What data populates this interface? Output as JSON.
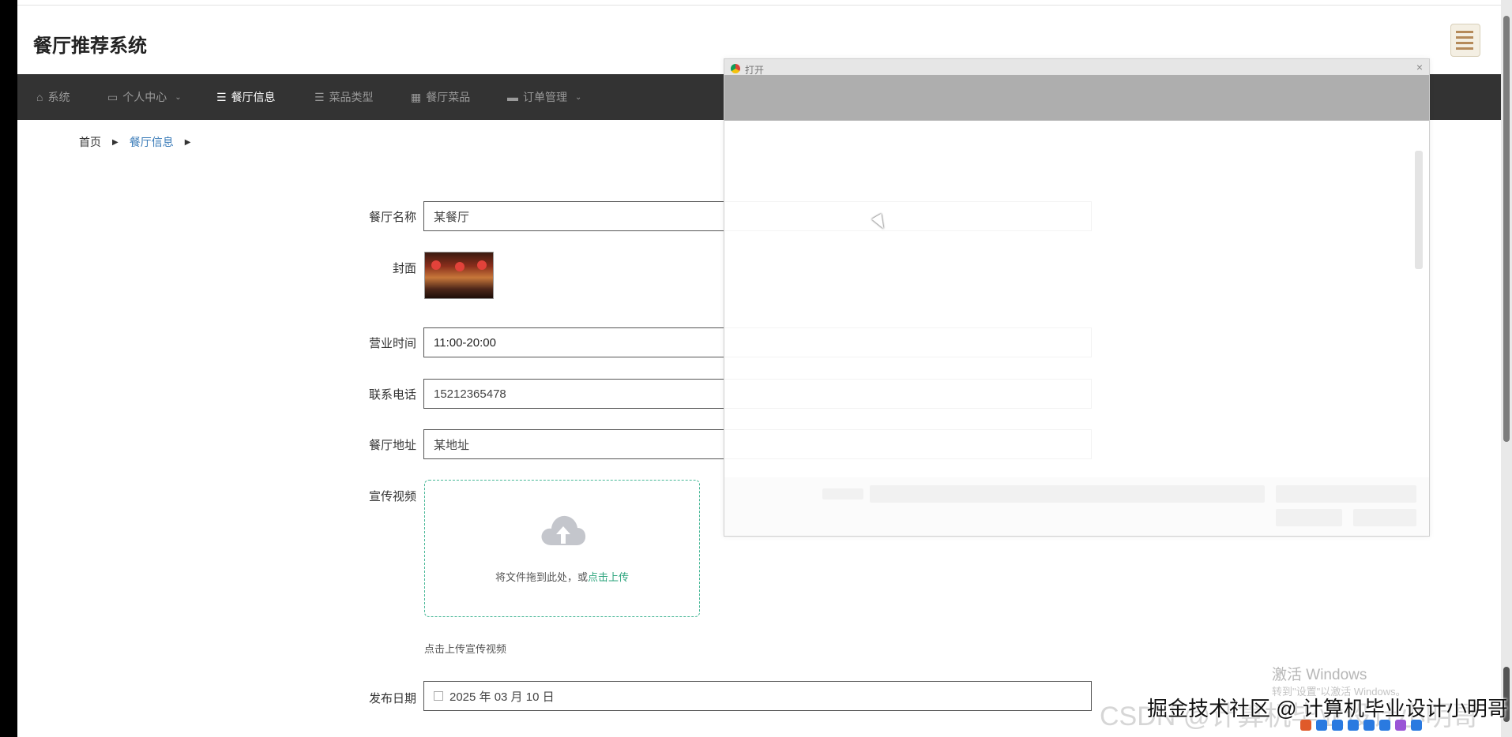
{
  "app": {
    "title": "餐厅推荐系统"
  },
  "nav": [
    {
      "label": "系统",
      "icon": "home-icon",
      "active": false,
      "dropdown": false
    },
    {
      "label": "个人中心",
      "icon": "card-icon",
      "active": false,
      "dropdown": true
    },
    {
      "label": "餐厅信息",
      "icon": "list-icon",
      "active": true,
      "dropdown": false
    },
    {
      "label": "菜品类型",
      "icon": "list-icon",
      "active": false,
      "dropdown": false
    },
    {
      "label": "餐厅菜品",
      "icon": "grid-icon",
      "active": false,
      "dropdown": false
    },
    {
      "label": "订单管理",
      "icon": "monitor-icon",
      "active": false,
      "dropdown": true
    }
  ],
  "breadcrumb": [
    "首页",
    "餐厅信息"
  ],
  "form": {
    "name_label": "餐厅名称",
    "name_value": "某餐厅",
    "cover_label": "封面",
    "hours_label": "营业时间",
    "hours_value": "11:00-20:00",
    "phone_label": "联系电话",
    "phone_value": "15212365478",
    "address_label": "餐厅地址",
    "address_value": "某地址",
    "video_label": "宣传视频",
    "upload_text": "将文件拖到此处，或",
    "upload_link": "点击上传",
    "upload_tip": "点击上传宣传视频",
    "date_label": "发布日期",
    "date_value": "2025 年 03 月 10 日"
  },
  "dialog": {
    "title": "打开",
    "close": "×"
  },
  "overlay": {
    "windows_activate": "激活 Windows",
    "windows_activate_sub": "转到\"设置\"以激活 Windows。",
    "watermark_juejin": "掘金技术社区 @ 计算机毕业设计小明哥",
    "watermark_csdn": "CSDN @计算机毕业设计小明哥"
  },
  "colors": {
    "navbar": "#333333",
    "active_nav": "#ffffff",
    "link": "#3a7bb8",
    "upload_border": "#46b796",
    "upload_link": "#2ea57e"
  }
}
